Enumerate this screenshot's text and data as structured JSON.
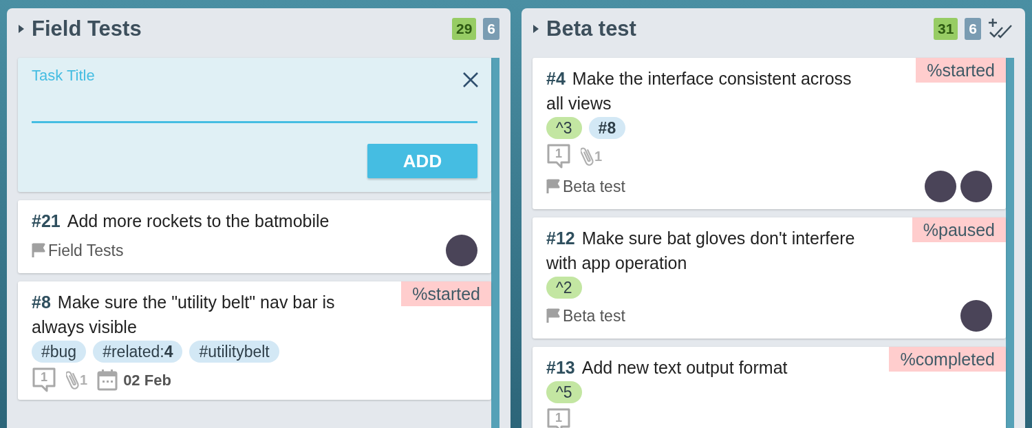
{
  "columns": [
    {
      "title": "Field Tests",
      "expanded": false,
      "counts": [
        {
          "kind": "points",
          "text": "29"
        },
        {
          "kind": "tasks",
          "text": "6"
        }
      ],
      "bulk_action": false,
      "add_form": {
        "label": "Task Title",
        "button": "ADD"
      },
      "cards": [
        {
          "number": "#21",
          "title": "Add more rockets to the batmobile",
          "milestone": "Field Tests",
          "avatars": [
            {
              "kind": "photo"
            }
          ]
        },
        {
          "number": "#8",
          "title": "Make sure the \"utility belt\" nav bar is always visible",
          "status": "%started",
          "tags": [
            {
              "kind": "tag",
              "text": "#bug"
            },
            {
              "kind": "tag",
              "text": "#related:**4**"
            },
            {
              "kind": "tag",
              "text": "#utilitybelt"
            }
          ],
          "meta": {
            "comments": "1",
            "attachments": "1",
            "due": "02 Feb"
          }
        }
      ]
    },
    {
      "title": "Beta test",
      "expanded": false,
      "counts": [
        {
          "kind": "points",
          "text": "31"
        },
        {
          "kind": "tasks",
          "text": "6"
        }
      ],
      "bulk_action": true,
      "cards": [
        {
          "number": "#4",
          "title": "Make the interface consistent across all views",
          "status": "%started",
          "tags": [
            {
              "kind": "estimate",
              "text": "^3"
            },
            {
              "kind": "ref",
              "text": "#8"
            }
          ],
          "meta": {
            "comments": "1",
            "attachments": "1"
          },
          "milestone": "Beta test",
          "avatars": [
            {
              "kind": "photo"
            },
            {
              "kind": "photo"
            }
          ]
        },
        {
          "number": "#12",
          "title": "Make sure bat gloves don't interfere with app operation",
          "status": "%paused",
          "tags": [
            {
              "kind": "estimate",
              "text": "^2"
            }
          ],
          "milestone": "Beta test",
          "avatars": [
            {
              "kind": "photo"
            }
          ]
        },
        {
          "number": "#13",
          "title": "Add new text output format",
          "status": "%completed",
          "tags": [
            {
              "kind": "estimate",
              "text": "^5"
            }
          ],
          "meta": {
            "comments": "1"
          }
        }
      ]
    }
  ]
}
